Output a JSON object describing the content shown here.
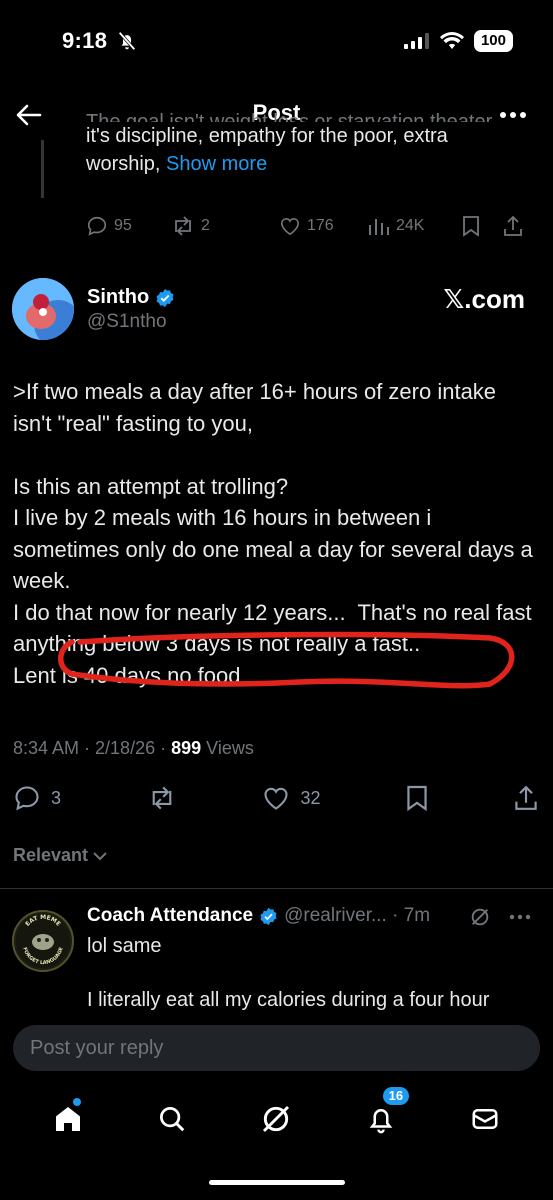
{
  "status_bar": {
    "time": "9:18",
    "battery": "100"
  },
  "header": {
    "title": "Post"
  },
  "previous_post": {
    "text_cut": "The goal isn't weight loss or starvation theater.",
    "text": "it's discipline, empathy for the poor, extra worship,",
    "show_more": "Show more",
    "replies": "95",
    "reposts": "2",
    "likes": "176",
    "views": "24K"
  },
  "post": {
    "author_name": "Sintho",
    "author_handle": "@S1ntho",
    "watermark": "𝕏.com",
    "body": ">If two meals a day after 16+ hours of zero intake isn't \"real\" fasting to you,\n\nIs this an attempt at trolling?\nI live by 2 meals with 16 hours in between i sometimes only do one meal a day for several days a week.\nI do that now for nearly 12 years...  That's no real fast anything below 3 days is not really a fast..\nLent is 40 days no food",
    "time": "8:34 AM · 2/18/26 · ",
    "views_count": "899",
    "views_label": " Views",
    "replies": "3",
    "likes": "32"
  },
  "relevant": {
    "label": "Relevant"
  },
  "reply": {
    "author_name": "Coach Attendance",
    "handle_time": "@realriver... · 7m",
    "line1": "lol same",
    "line2": "I literally eat all my calories during a four hour",
    "avatar_text_top": "EAT MEME",
    "avatar_text_bottom": "FORGET LANGUAGE"
  },
  "composer": {
    "placeholder": "Post your reply"
  },
  "tabbar": {
    "notifications_badge": "16"
  },
  "colors": {
    "accent": "#1d9bf0",
    "annotation": "#e0241b",
    "muted": "#71767b"
  }
}
